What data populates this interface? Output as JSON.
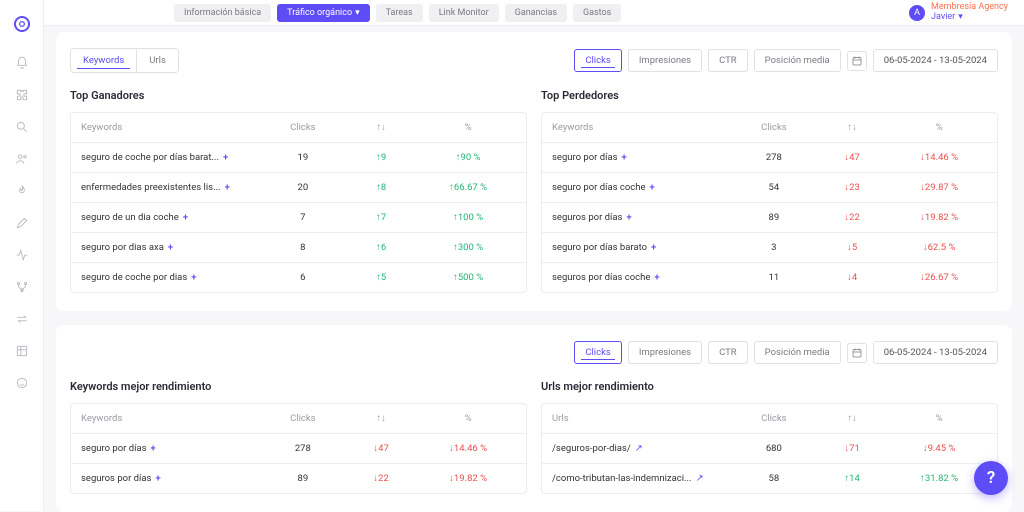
{
  "user": {
    "membership_label": "Membresía Agency",
    "name": "Javier",
    "avatar_letter": "A"
  },
  "header_tabs": {
    "basic": "Información básica",
    "traffic": "Tráfico orgánico",
    "tasks": "Tareas",
    "link_monitor": "Link Monitor",
    "earnings": "Ganancias",
    "expenses": "Gastos"
  },
  "subtabs": {
    "keywords": "Keywords",
    "urls": "Urls"
  },
  "metric_tabs": {
    "clicks": "Clicks",
    "impressions": "Impresiones",
    "ctr": "CTR",
    "avg_position": "Posición media"
  },
  "date_range": "06-05-2024 - 13-05-2024",
  "table_headers": {
    "keywords": "Keywords",
    "urls": "Urls",
    "clicks": "Clicks",
    "delta": "↑↓",
    "pct": "%"
  },
  "section_titles": {
    "winners": "Top Ganadores",
    "losers": "Top Perdedores",
    "kw_best": "Keywords mejor rendimiento",
    "url_best": "Urls mejor rendimiento"
  },
  "winners": [
    {
      "kw": "seguro de coche por días barat...",
      "clicks": "19",
      "delta": "9",
      "pct": "90 %",
      "dir": "up"
    },
    {
      "kw": "enfermedades preexistentes lis...",
      "clicks": "20",
      "delta": "8",
      "pct": "66.67 %",
      "dir": "up"
    },
    {
      "kw": "seguro de un dia coche",
      "clicks": "7",
      "delta": "7",
      "pct": "100 %",
      "dir": "up"
    },
    {
      "kw": "seguro por dias axa",
      "clicks": "8",
      "delta": "6",
      "pct": "300 %",
      "dir": "up"
    },
    {
      "kw": "seguro de coche por dias",
      "clicks": "6",
      "delta": "5",
      "pct": "500 %",
      "dir": "up"
    }
  ],
  "losers": [
    {
      "kw": "seguro por días",
      "clicks": "278",
      "delta": "47",
      "pct": "14.46 %",
      "dir": "down"
    },
    {
      "kw": "seguro por días coche",
      "clicks": "54",
      "delta": "23",
      "pct": "29.87 %",
      "dir": "down"
    },
    {
      "kw": "seguros por días",
      "clicks": "89",
      "delta": "22",
      "pct": "19.82 %",
      "dir": "down"
    },
    {
      "kw": "seguro por días barato",
      "clicks": "3",
      "delta": "5",
      "pct": "62.5 %",
      "dir": "down"
    },
    {
      "kw": "seguros por días coche",
      "clicks": "11",
      "delta": "4",
      "pct": "26.67 %",
      "dir": "down"
    }
  ],
  "kw_best": [
    {
      "kw": "seguro por días",
      "clicks": "278",
      "delta": "47",
      "pct": "14.46 %",
      "dir": "down"
    },
    {
      "kw": "seguros por días",
      "clicks": "89",
      "delta": "22",
      "pct": "19.82 %",
      "dir": "down"
    }
  ],
  "url_best": [
    {
      "kw": "/seguros-por-dias/",
      "clicks": "680",
      "delta": "71",
      "pct": "9.45 %",
      "dir": "down",
      "ext": true
    },
    {
      "kw": "/como-tributan-las-indemnizaci...",
      "clicks": "58",
      "delta": "14",
      "pct": "31.82 %",
      "dir": "up",
      "ext": true
    }
  ]
}
